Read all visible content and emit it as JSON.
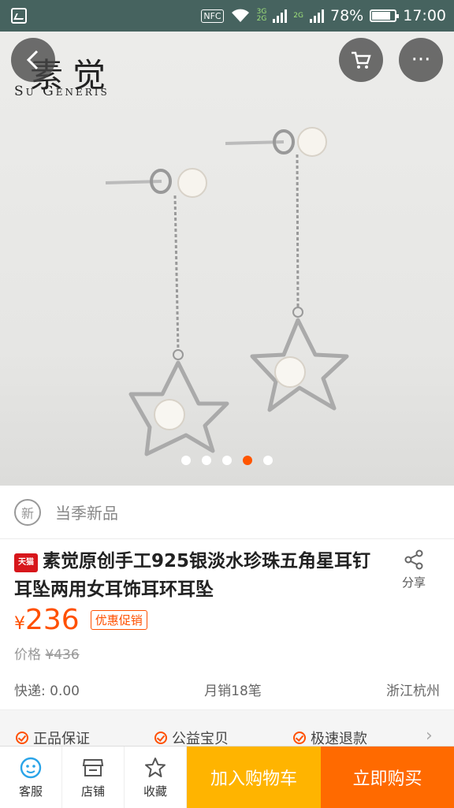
{
  "status_bar": {
    "nfc": "NFC",
    "net_a": "3G",
    "net_b": "2G",
    "net_c": "2G",
    "battery": "78%",
    "time": "17:00"
  },
  "hero": {
    "brand_cn": "素觉",
    "brand_en": "Su Generis",
    "carousel_index": 4,
    "carousel_total": 5
  },
  "product": {
    "new_badge": "新",
    "new_label": "当季新品",
    "store_badge": "天猫",
    "title": "素觉原创手工925银淡水珍珠五角星耳钉耳坠两用女耳饰耳环耳坠",
    "share_label": "分享",
    "currency": "¥",
    "price": "236",
    "promo_label": "优惠促销",
    "orig_label": "价格",
    "orig_price": "¥436",
    "shipping": "快递: 0.00",
    "monthly_sales": "月销18笔",
    "location": "浙江杭州"
  },
  "guarantees": [
    "正品保证",
    "公益宝贝",
    "极速退款"
  ],
  "bottom_bar": {
    "service": "客服",
    "shop": "店铺",
    "favorite": "收藏",
    "add_to_cart": "加入购物车",
    "buy_now": "立即购买"
  },
  "colors": {
    "accent": "#ff5000",
    "cart_button": "#ffb400",
    "buy_button": "#ff6a00",
    "status_bar": "#46635f"
  }
}
